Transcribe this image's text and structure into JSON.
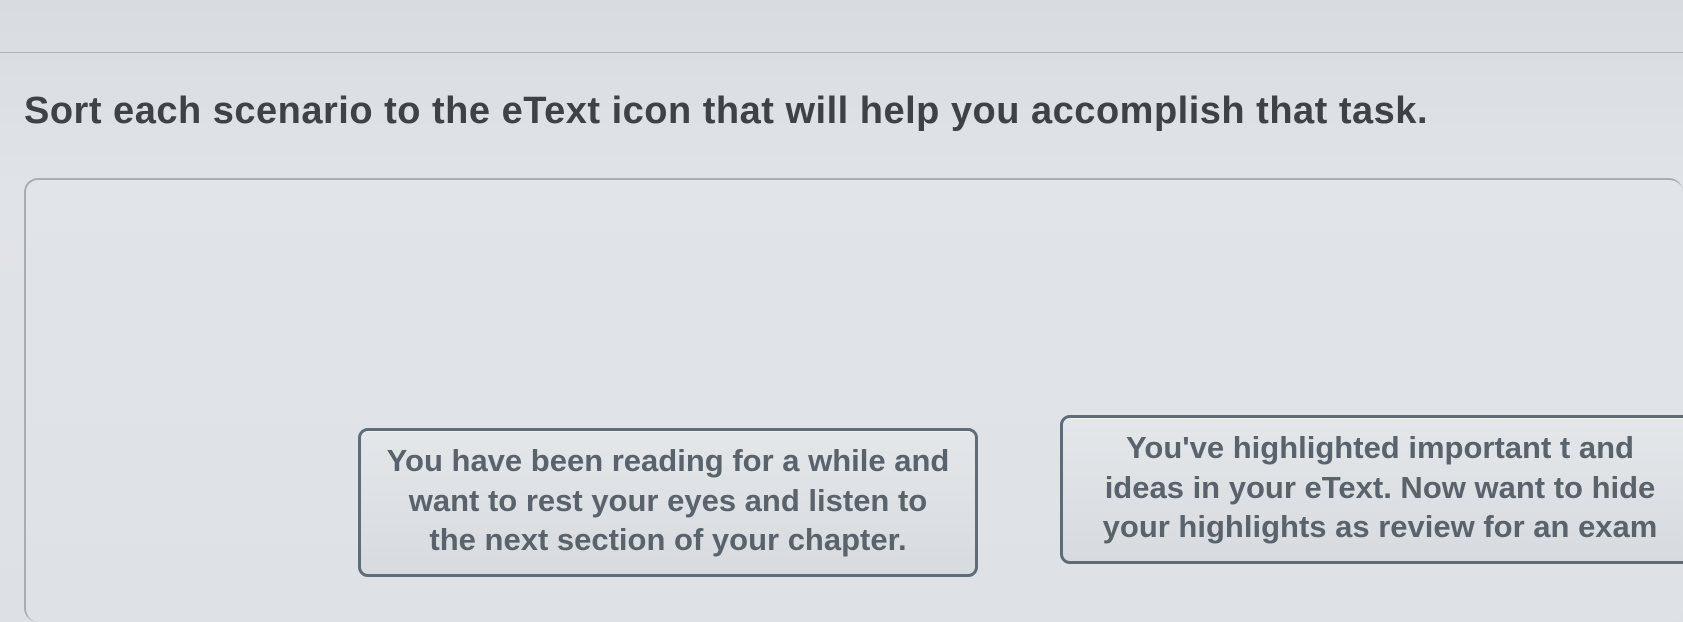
{
  "instruction": "Sort each scenario to the eText icon that will help you accomplish that task.",
  "cards": [
    {
      "text": "You have been reading for a while and want to rest your eyes and listen to the next section of your chapter."
    },
    {
      "text": "You've highlighted important t and ideas in your eText. Now want to hide your highlights as review for an exam"
    }
  ]
}
